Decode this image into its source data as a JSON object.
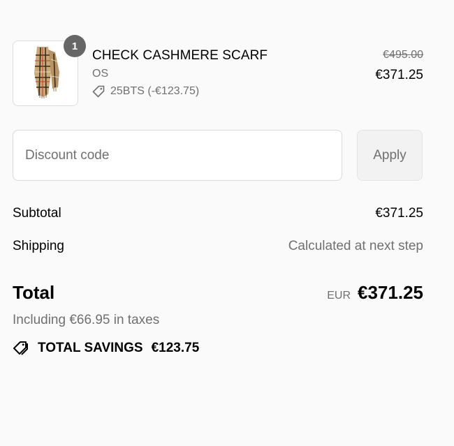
{
  "cart": {
    "item": {
      "quantity": "1",
      "name": "CHECK CASHMERE SCARF",
      "variant": "OS",
      "discount_tag": "25BTS (-€123.75)",
      "original_price": "€495.00",
      "price": "€371.25",
      "image_icon": "scarf-image"
    }
  },
  "discount": {
    "placeholder": "Discount code",
    "apply_label": "Apply"
  },
  "summary": {
    "subtotal_label": "Subtotal",
    "subtotal_value": "€371.25",
    "shipping_label": "Shipping",
    "shipping_value": "Calculated at next step",
    "total_label": "Total",
    "currency": "EUR",
    "total_value": "€371.25",
    "taxes_note": "Including €66.95 in taxes",
    "savings_label": "TOTAL SAVINGS",
    "savings_value": "€123.75"
  }
}
